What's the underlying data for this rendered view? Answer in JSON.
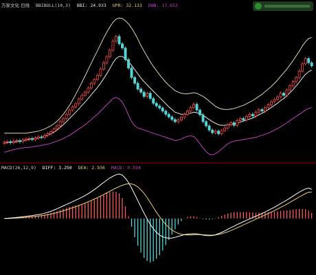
{
  "header_top": {
    "symbol": "万家文化 日线",
    "indicator": "BBIBOLL(10,3)",
    "bbi_label": "BBI: 24.933",
    "upr_label": "UPR: 32.133",
    "dwn_label": "DWN: 17.653"
  },
  "header_bottom": {
    "indicator": "MACD(26,12,9)",
    "diff_label": "DIFF: 3.250",
    "dea_label": "DEA: 2.936",
    "macd_label": "MACD: 0.594"
  },
  "colors": {
    "background": "#000000",
    "up_candle": "#ff4a4a",
    "down_candle": "#55d6d6",
    "bbi_line": "#e8e8e8",
    "upr_line": "#d8d8b0",
    "dwn_line": "#c040c0",
    "diff_line": "#ffffff",
    "dea_line": "#e8d06a",
    "hist_pos": "#ff5a5a",
    "hist_neg": "#55d6d6",
    "divider": "#a00000"
  },
  "chart_data": [
    {
      "type": "candlestick",
      "panel": "price",
      "grid": false,
      "legend": "none",
      "x_count": 100,
      "closes": [
        15.3,
        15.4,
        15.2,
        15.5,
        15.6,
        15.4,
        15.7,
        15.9,
        16.0,
        15.8,
        16.1,
        16.3,
        16.2,
        16.6,
        16.9,
        17.3,
        17.8,
        18.4,
        19.2,
        19.8,
        20.6,
        21.4,
        22.0,
        22.6,
        23.5,
        24.2,
        24.8,
        25.6,
        26.5,
        27.2,
        28.0,
        29.2,
        30.4,
        31.5,
        32.8,
        34.5,
        35.4,
        34.0,
        33.2,
        31.0,
        29.4,
        27.6,
        26.5,
        25.4,
        24.8,
        24.0,
        24.6,
        23.6,
        22.7,
        22.2,
        21.8,
        21.2,
        20.6,
        20.1,
        19.6,
        19.2,
        19.5,
        20.0,
        20.6,
        21.2,
        21.9,
        22.5,
        21.4,
        20.5,
        19.2,
        18.4,
        17.6,
        17.1,
        17.4,
        16.9,
        17.5,
        18.0,
        18.6,
        19.0,
        18.5,
        19.4,
        19.8,
        19.5,
        20.2,
        20.6,
        20.3,
        21.0,
        21.5,
        21.2,
        21.9,
        22.4,
        23.0,
        23.4,
        23.9,
        24.6,
        24.2,
        25.2,
        26.0,
        26.8,
        27.6,
        28.8,
        30.2,
        31.2,
        30.4,
        29.8
      ],
      "bbi": [
        15.1,
        15.2,
        15.3,
        15.3,
        15.4,
        15.5,
        15.6,
        15.7,
        15.8,
        15.9,
        16.0,
        16.1,
        16.2,
        16.4,
        16.6,
        16.9,
        17.2,
        17.6,
        18.1,
        18.6,
        19.2,
        19.8,
        20.4,
        21.0,
        21.6,
        22.3,
        22.9,
        23.6,
        24.3,
        25.0,
        25.7,
        26.5,
        27.4,
        28.3,
        29.3,
        30.4,
        31.2,
        31.6,
        31.6,
        31.2,
        30.6,
        29.9,
        29.1,
        28.3,
        27.5,
        26.8,
        26.2,
        25.6,
        25.0,
        24.4,
        23.8,
        23.2,
        22.6,
        22.0,
        21.5,
        21.0,
        20.8,
        20.6,
        20.6,
        20.7,
        20.8,
        21.0,
        20.9,
        20.7,
        20.4,
        20.0,
        19.6,
        19.2,
        18.9,
        18.6,
        18.5,
        18.5,
        18.6,
        18.7,
        18.8,
        18.9,
        19.1,
        19.3,
        19.5,
        19.7,
        19.9,
        20.2,
        20.5,
        20.8,
        21.1,
        21.5,
        21.9,
        22.3,
        22.7,
        23.2,
        23.6,
        24.1,
        24.7,
        25.3,
        26.0,
        26.7,
        27.5,
        28.2,
        28.7,
        29.0
      ],
      "upr": [
        17.0,
        17.0,
        17.0,
        17.0,
        17.0,
        17.0,
        17.0,
        17.0,
        17.1,
        17.2,
        17.3,
        17.4,
        17.6,
        17.8,
        18.1,
        18.4,
        18.8,
        19.3,
        19.9,
        20.6,
        21.4,
        22.3,
        23.3,
        24.4,
        25.5,
        26.7,
        27.9,
        29.1,
        30.3,
        31.5,
        32.7,
        33.9,
        35.1,
        36.2,
        37.2,
        38.1,
        38.7,
        38.9,
        38.8,
        38.4,
        37.8,
        37.0,
        36.0,
        34.9,
        33.7,
        32.6,
        31.6,
        30.6,
        29.7,
        28.9,
        28.1,
        27.4,
        26.7,
        26.1,
        25.6,
        25.1,
        24.8,
        24.6,
        24.5,
        24.5,
        24.6,
        24.7,
        24.6,
        24.3,
        24.0,
        23.6,
        23.1,
        22.6,
        22.1,
        21.8,
        21.6,
        21.5,
        21.5,
        21.6,
        21.7,
        21.9,
        22.1,
        22.3,
        22.6,
        22.9,
        23.2,
        23.6,
        24.0,
        24.4,
        24.9,
        25.4,
        25.9,
        26.5,
        27.1,
        27.8,
        28.5,
        29.2,
        30.0,
        30.8,
        31.7,
        32.6,
        33.6,
        34.4,
        35.0,
        35.2
      ],
      "dwn": [
        13.4,
        13.5,
        13.7,
        13.9,
        14.0,
        14.1,
        14.2,
        14.3,
        14.3,
        14.4,
        14.5,
        14.6,
        14.7,
        14.8,
        14.9,
        15.1,
        15.3,
        15.5,
        15.7,
        16.0,
        16.3,
        16.6,
        17.0,
        17.4,
        17.8,
        18.2,
        18.6,
        19.1,
        19.6,
        20.1,
        20.6,
        21.2,
        21.8,
        22.4,
        23.0,
        23.6,
        23.8,
        23.5,
        22.9,
        21.8,
        20.4,
        19.2,
        18.4,
        18.0,
        17.8,
        17.6,
        17.4,
        17.2,
        17.0,
        16.8,
        16.6,
        16.4,
        16.2,
        16.0,
        15.8,
        15.6,
        15.7,
        15.9,
        16.2,
        16.4,
        16.5,
        16.4,
        15.8,
        15.0,
        14.2,
        13.5,
        13.0,
        12.9,
        13.1,
        13.5,
        14.0,
        14.5,
        15.0,
        15.3,
        15.5,
        15.6,
        15.7,
        15.8,
        15.9,
        16.0,
        16.1,
        16.2,
        16.4,
        16.6,
        16.8,
        17.0,
        17.3,
        17.6,
        17.9,
        18.2,
        18.6,
        19.0,
        19.4,
        19.8,
        20.2,
        20.6,
        21.0,
        21.4,
        21.7,
        21.9
      ],
      "ylim": [
        12.0,
        40.5
      ]
    },
    {
      "type": "macd",
      "panel": "indicator",
      "grid": false,
      "legend": "none",
      "x_count": 100,
      "diff": [
        0.0,
        0.02,
        0.05,
        0.08,
        0.12,
        0.16,
        0.2,
        0.24,
        0.28,
        0.32,
        0.38,
        0.44,
        0.5,
        0.58,
        0.68,
        0.8,
        0.94,
        1.08,
        1.24,
        1.4,
        1.56,
        1.72,
        1.88,
        2.04,
        2.2,
        2.38,
        2.56,
        2.76,
        2.98,
        3.22,
        3.48,
        3.76,
        4.02,
        4.28,
        4.52,
        4.72,
        4.88,
        4.96,
        4.84,
        4.5,
        4.0,
        3.4,
        2.7,
        2.0,
        1.3,
        0.6,
        -0.05,
        -0.65,
        -1.15,
        -1.55,
        -1.85,
        -2.05,
        -2.15,
        -2.2,
        -2.18,
        -2.1,
        -2.0,
        -1.9,
        -1.8,
        -1.75,
        -1.72,
        -1.7,
        -1.72,
        -1.78,
        -1.85,
        -1.9,
        -1.92,
        -1.9,
        -1.82,
        -1.7,
        -1.55,
        -1.38,
        -1.2,
        -1.02,
        -0.85,
        -0.68,
        -0.52,
        -0.36,
        -0.2,
        -0.05,
        0.1,
        0.25,
        0.4,
        0.56,
        0.72,
        0.9,
        1.08,
        1.26,
        1.46,
        1.66,
        1.86,
        2.06,
        2.28,
        2.5,
        2.72,
        2.94,
        3.14,
        3.3,
        3.38,
        3.25
      ],
      "dea": [
        0.0,
        0.0,
        0.01,
        0.03,
        0.05,
        0.07,
        0.1,
        0.13,
        0.16,
        0.19,
        0.23,
        0.27,
        0.31,
        0.36,
        0.42,
        0.49,
        0.57,
        0.66,
        0.76,
        0.86,
        0.97,
        1.08,
        1.2,
        1.32,
        1.45,
        1.58,
        1.72,
        1.86,
        2.01,
        2.17,
        2.33,
        2.5,
        2.68,
        2.86,
        3.04,
        3.22,
        3.4,
        3.56,
        3.7,
        3.82,
        3.88,
        3.86,
        3.74,
        3.52,
        3.2,
        2.8,
        2.32,
        1.8,
        1.24,
        0.7,
        0.2,
        -0.26,
        -0.66,
        -1.0,
        -1.28,
        -1.5,
        -1.66,
        -1.76,
        -1.82,
        -1.84,
        -1.84,
        -1.82,
        -1.8,
        -1.8,
        -1.82,
        -1.84,
        -1.86,
        -1.86,
        -1.84,
        -1.78,
        -1.7,
        -1.6,
        -1.48,
        -1.34,
        -1.2,
        -1.04,
        -0.88,
        -0.72,
        -0.56,
        -0.4,
        -0.24,
        -0.08,
        0.08,
        0.24,
        0.4,
        0.56,
        0.72,
        0.88,
        1.06,
        1.24,
        1.42,
        1.6,
        1.8,
        2.0,
        2.2,
        2.4,
        2.6,
        2.78,
        2.94,
        2.94
      ],
      "macd": [
        0.0,
        0.04,
        0.08,
        0.1,
        0.14,
        0.18,
        0.2,
        0.22,
        0.24,
        0.26,
        0.3,
        0.34,
        0.38,
        0.44,
        0.52,
        0.62,
        0.74,
        0.84,
        0.96,
        1.08,
        1.18,
        1.28,
        1.36,
        1.44,
        1.5,
        1.6,
        1.68,
        1.8,
        1.94,
        2.1,
        2.3,
        2.52,
        2.68,
        2.84,
        2.96,
        3.0,
        2.96,
        2.8,
        2.28,
        1.36,
        0.24,
        -0.92,
        -2.08,
        -3.04,
        -3.8,
        -4.4,
        -4.74,
        -4.9,
        -4.78,
        -4.5,
        -4.1,
        -3.58,
        -2.98,
        -2.4,
        -1.8,
        -1.2,
        -0.68,
        -0.28,
        0.04,
        0.18,
        0.24,
        0.24,
        0.16,
        0.04,
        -0.06,
        -0.12,
        -0.12,
        -0.08,
        0.04,
        0.16,
        0.3,
        0.44,
        0.56,
        0.64,
        0.7,
        0.72,
        0.72,
        0.72,
        0.72,
        0.7,
        0.68,
        0.66,
        0.64,
        0.64,
        0.64,
        0.68,
        0.72,
        0.76,
        0.8,
        0.84,
        0.88,
        0.92,
        0.96,
        1.0,
        1.04,
        1.08,
        1.08,
        1.04,
        0.88,
        0.62
      ],
      "ylim": [
        -6.0,
        5.2
      ]
    }
  ]
}
